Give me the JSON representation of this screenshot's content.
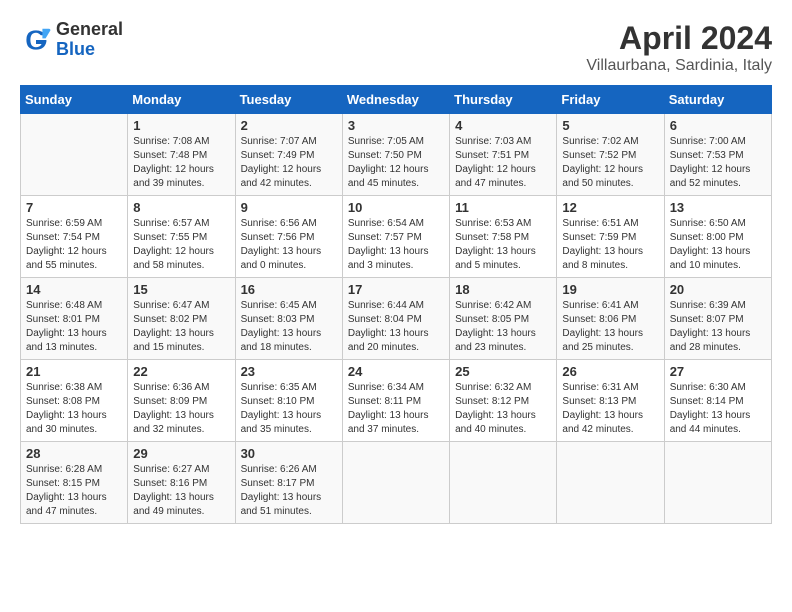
{
  "header": {
    "logo_general": "General",
    "logo_blue": "Blue",
    "month_year": "April 2024",
    "location": "Villaurbana, Sardinia, Italy"
  },
  "calendar": {
    "days_of_week": [
      "Sunday",
      "Monday",
      "Tuesday",
      "Wednesday",
      "Thursday",
      "Friday",
      "Saturday"
    ],
    "weeks": [
      [
        {
          "day": "",
          "info": ""
        },
        {
          "day": "1",
          "info": "Sunrise: 7:08 AM\nSunset: 7:48 PM\nDaylight: 12 hours\nand 39 minutes."
        },
        {
          "day": "2",
          "info": "Sunrise: 7:07 AM\nSunset: 7:49 PM\nDaylight: 12 hours\nand 42 minutes."
        },
        {
          "day": "3",
          "info": "Sunrise: 7:05 AM\nSunset: 7:50 PM\nDaylight: 12 hours\nand 45 minutes."
        },
        {
          "day": "4",
          "info": "Sunrise: 7:03 AM\nSunset: 7:51 PM\nDaylight: 12 hours\nand 47 minutes."
        },
        {
          "day": "5",
          "info": "Sunrise: 7:02 AM\nSunset: 7:52 PM\nDaylight: 12 hours\nand 50 minutes."
        },
        {
          "day": "6",
          "info": "Sunrise: 7:00 AM\nSunset: 7:53 PM\nDaylight: 12 hours\nand 52 minutes."
        }
      ],
      [
        {
          "day": "7",
          "info": "Sunrise: 6:59 AM\nSunset: 7:54 PM\nDaylight: 12 hours\nand 55 minutes."
        },
        {
          "day": "8",
          "info": "Sunrise: 6:57 AM\nSunset: 7:55 PM\nDaylight: 12 hours\nand 58 minutes."
        },
        {
          "day": "9",
          "info": "Sunrise: 6:56 AM\nSunset: 7:56 PM\nDaylight: 13 hours\nand 0 minutes."
        },
        {
          "day": "10",
          "info": "Sunrise: 6:54 AM\nSunset: 7:57 PM\nDaylight: 13 hours\nand 3 minutes."
        },
        {
          "day": "11",
          "info": "Sunrise: 6:53 AM\nSunset: 7:58 PM\nDaylight: 13 hours\nand 5 minutes."
        },
        {
          "day": "12",
          "info": "Sunrise: 6:51 AM\nSunset: 7:59 PM\nDaylight: 13 hours\nand 8 minutes."
        },
        {
          "day": "13",
          "info": "Sunrise: 6:50 AM\nSunset: 8:00 PM\nDaylight: 13 hours\nand 10 minutes."
        }
      ],
      [
        {
          "day": "14",
          "info": "Sunrise: 6:48 AM\nSunset: 8:01 PM\nDaylight: 13 hours\nand 13 minutes."
        },
        {
          "day": "15",
          "info": "Sunrise: 6:47 AM\nSunset: 8:02 PM\nDaylight: 13 hours\nand 15 minutes."
        },
        {
          "day": "16",
          "info": "Sunrise: 6:45 AM\nSunset: 8:03 PM\nDaylight: 13 hours\nand 18 minutes."
        },
        {
          "day": "17",
          "info": "Sunrise: 6:44 AM\nSunset: 8:04 PM\nDaylight: 13 hours\nand 20 minutes."
        },
        {
          "day": "18",
          "info": "Sunrise: 6:42 AM\nSunset: 8:05 PM\nDaylight: 13 hours\nand 23 minutes."
        },
        {
          "day": "19",
          "info": "Sunrise: 6:41 AM\nSunset: 8:06 PM\nDaylight: 13 hours\nand 25 minutes."
        },
        {
          "day": "20",
          "info": "Sunrise: 6:39 AM\nSunset: 8:07 PM\nDaylight: 13 hours\nand 28 minutes."
        }
      ],
      [
        {
          "day": "21",
          "info": "Sunrise: 6:38 AM\nSunset: 8:08 PM\nDaylight: 13 hours\nand 30 minutes."
        },
        {
          "day": "22",
          "info": "Sunrise: 6:36 AM\nSunset: 8:09 PM\nDaylight: 13 hours\nand 32 minutes."
        },
        {
          "day": "23",
          "info": "Sunrise: 6:35 AM\nSunset: 8:10 PM\nDaylight: 13 hours\nand 35 minutes."
        },
        {
          "day": "24",
          "info": "Sunrise: 6:34 AM\nSunset: 8:11 PM\nDaylight: 13 hours\nand 37 minutes."
        },
        {
          "day": "25",
          "info": "Sunrise: 6:32 AM\nSunset: 8:12 PM\nDaylight: 13 hours\nand 40 minutes."
        },
        {
          "day": "26",
          "info": "Sunrise: 6:31 AM\nSunset: 8:13 PM\nDaylight: 13 hours\nand 42 minutes."
        },
        {
          "day": "27",
          "info": "Sunrise: 6:30 AM\nSunset: 8:14 PM\nDaylight: 13 hours\nand 44 minutes."
        }
      ],
      [
        {
          "day": "28",
          "info": "Sunrise: 6:28 AM\nSunset: 8:15 PM\nDaylight: 13 hours\nand 47 minutes."
        },
        {
          "day": "29",
          "info": "Sunrise: 6:27 AM\nSunset: 8:16 PM\nDaylight: 13 hours\nand 49 minutes."
        },
        {
          "day": "30",
          "info": "Sunrise: 6:26 AM\nSunset: 8:17 PM\nDaylight: 13 hours\nand 51 minutes."
        },
        {
          "day": "",
          "info": ""
        },
        {
          "day": "",
          "info": ""
        },
        {
          "day": "",
          "info": ""
        },
        {
          "day": "",
          "info": ""
        }
      ]
    ]
  }
}
